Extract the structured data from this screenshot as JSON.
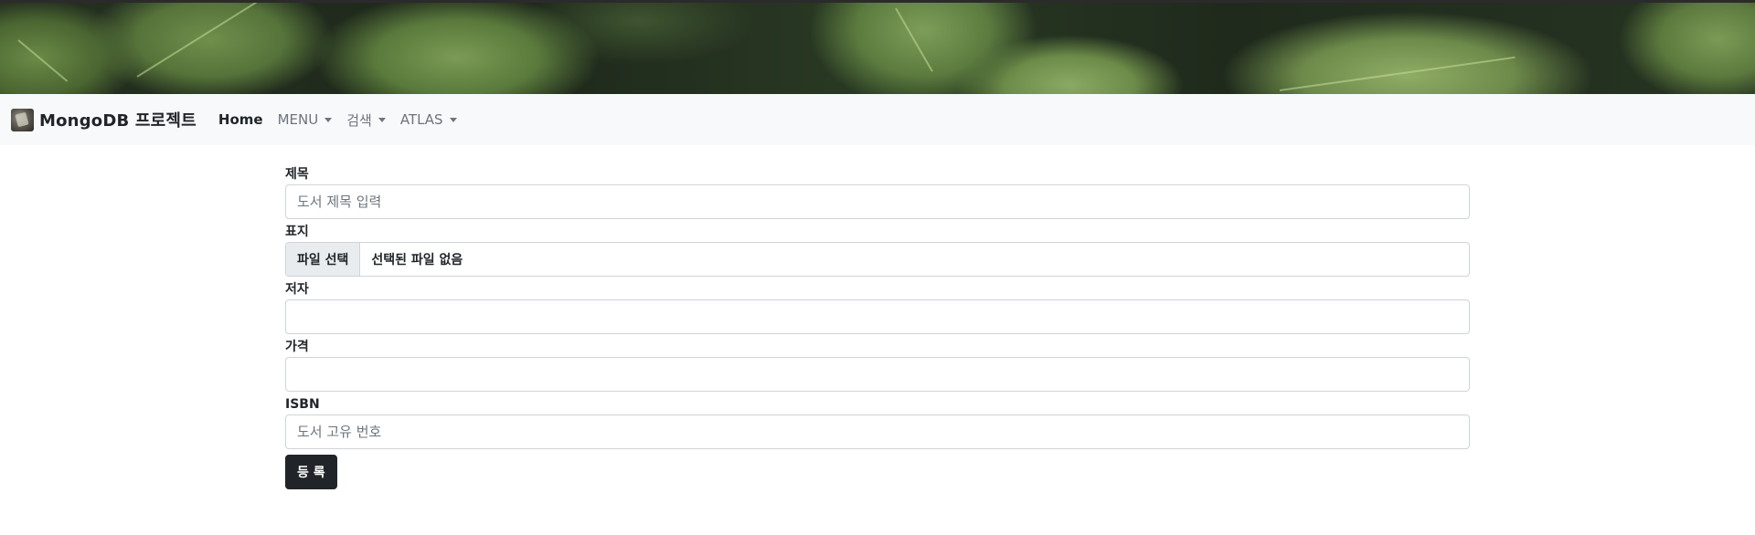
{
  "navbar": {
    "brand": "MongoDB 프로젝트",
    "items": [
      {
        "label": "Home",
        "dropdown": false,
        "active": true
      },
      {
        "label": "MENU",
        "dropdown": true,
        "active": false
      },
      {
        "label": "검색",
        "dropdown": true,
        "active": false
      },
      {
        "label": "ATLAS",
        "dropdown": true,
        "active": false
      }
    ]
  },
  "form": {
    "title": {
      "label": "제목",
      "value": "",
      "placeholder": "도서 제목 입력"
    },
    "cover": {
      "label": "표지",
      "button": "파일 선택",
      "status": "선택된 파일 없음"
    },
    "author": {
      "label": "저자",
      "value": "",
      "placeholder": ""
    },
    "price": {
      "label": "가격",
      "value": "",
      "placeholder": ""
    },
    "isbn": {
      "label": "ISBN",
      "value": "",
      "placeholder": "도서 고유 번호"
    },
    "submit": "등 록"
  },
  "colors": {
    "navbar_bg": "#f8f9fa",
    "submit_bg": "#212529"
  }
}
